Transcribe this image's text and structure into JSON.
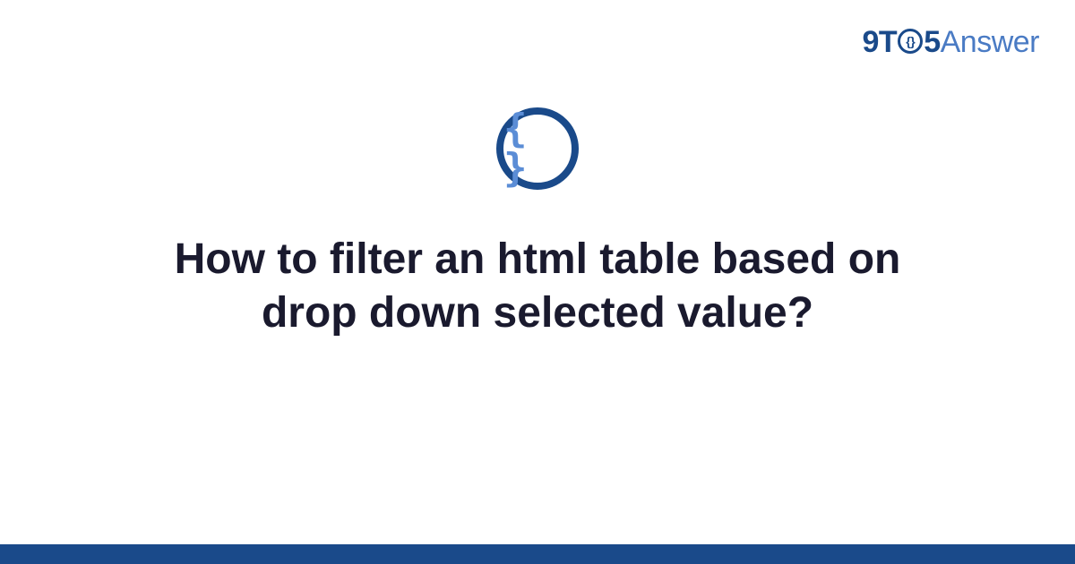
{
  "logo": {
    "part_9t": "9T",
    "part_o_inner": "{}",
    "part_5": "5",
    "part_answer": "Answer"
  },
  "icon": {
    "braces": "{ }"
  },
  "title": "How to filter an html table based on drop down selected value?"
}
